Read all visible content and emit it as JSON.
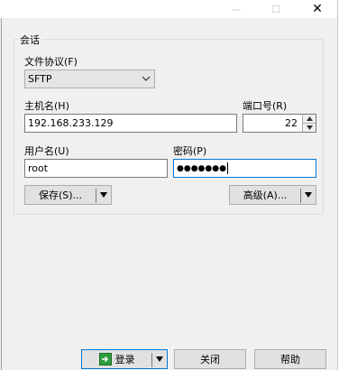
{
  "window": {
    "controls": {
      "minimize": "—",
      "maximize": "☐",
      "close": "✕"
    }
  },
  "session": {
    "group_title": "会话",
    "protocol": {
      "label": "文件协议(F)",
      "value": "SFTP"
    },
    "host": {
      "label": "主机名(H)",
      "value": "192.168.233.129"
    },
    "port": {
      "label": "端口号(R)",
      "value": "22"
    },
    "user": {
      "label": "用户名(U)",
      "value": "root"
    },
    "password": {
      "label": "密码(P)",
      "value": "●●●●●●●"
    },
    "save_button": "保存(S)...",
    "advanced_button": "高级(A)..."
  },
  "footer": {
    "login_button": "登录",
    "close_button": "关闭",
    "help_button": "帮助"
  }
}
